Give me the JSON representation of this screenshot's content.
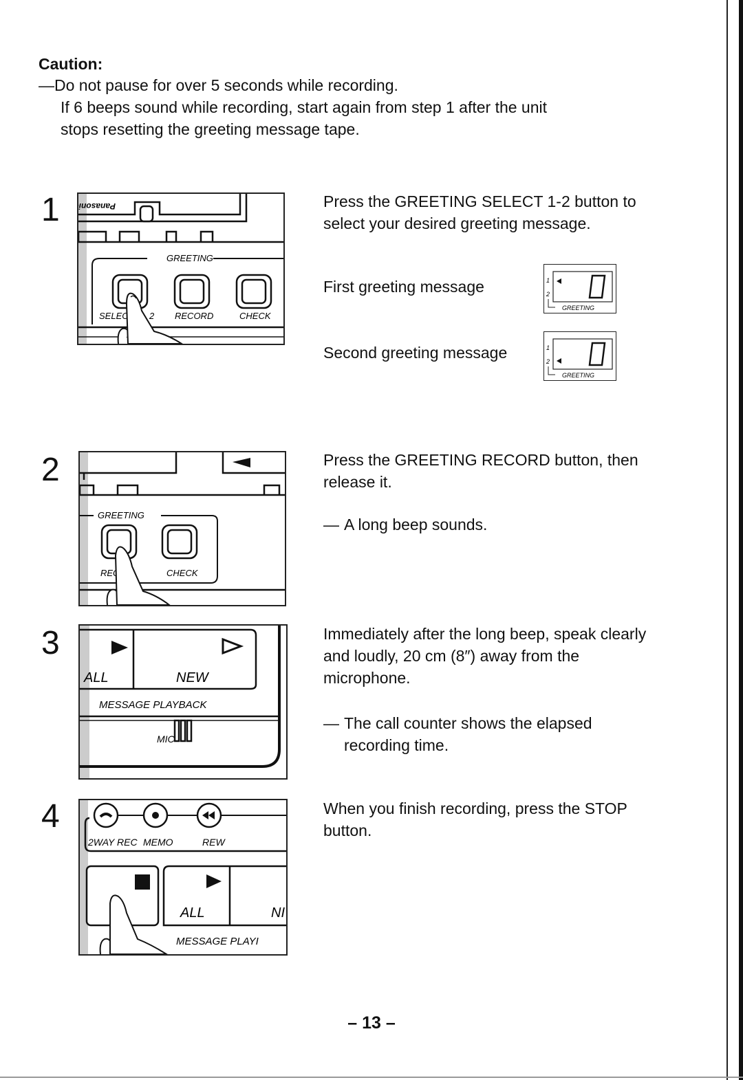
{
  "caution": {
    "title": "Caution:",
    "dash": "—",
    "line1": "Do not pause for over 5 seconds while recording.",
    "line2": "If 6 beeps sound while recording, start again from step 1 after the unit",
    "line3": "stops resetting the greeting message tape."
  },
  "steps": [
    {
      "number": "1",
      "text": "Press the GREETING SELECT 1-2 button to select your desired greeting message.",
      "illustration": {
        "brand": "Panasonic",
        "section": "GREETING",
        "buttons": [
          "SELECT 1-2",
          "RECORD",
          "CHECK"
        ],
        "label_select_visible": "SELEC",
        "label_select_suffix": "2"
      },
      "options": [
        {
          "label": "First greeting message",
          "display": {
            "selected": "1",
            "digit": "0",
            "caption": "GREETING",
            "rows": [
              "1",
              "2"
            ]
          }
        },
        {
          "label": "Second greeting message",
          "display": {
            "selected": "2",
            "digit": "0",
            "caption": "GREETING",
            "rows": [
              "1",
              "2"
            ]
          }
        }
      ]
    },
    {
      "number": "2",
      "text": "Press the GREETING RECORD button, then release it.",
      "note": "A long beep sounds.",
      "illustration": {
        "section": "GREETING",
        "buttons": [
          "REC",
          "CHECK"
        ]
      }
    },
    {
      "number": "3",
      "text": "Immediately after the long beep, speak clearly and loudly, 20 cm (8″) away from the microphone.",
      "note": "The call counter shows the elapsed recording time.",
      "illustration": {
        "buttons": [
          "ALL",
          "NEW"
        ],
        "section": "MESSAGE PLAYBACK",
        "mic": "MIC"
      }
    },
    {
      "number": "4",
      "text": "When you finish recording, press the STOP button.",
      "illustration": {
        "top_buttons": [
          "2WAY REC",
          "MEMO",
          "REW"
        ],
        "buttons": [
          "ALL",
          "NI"
        ],
        "section": "MESSAGE PLAYI"
      }
    }
  ],
  "dash": "—",
  "page_number": "– 13 –"
}
